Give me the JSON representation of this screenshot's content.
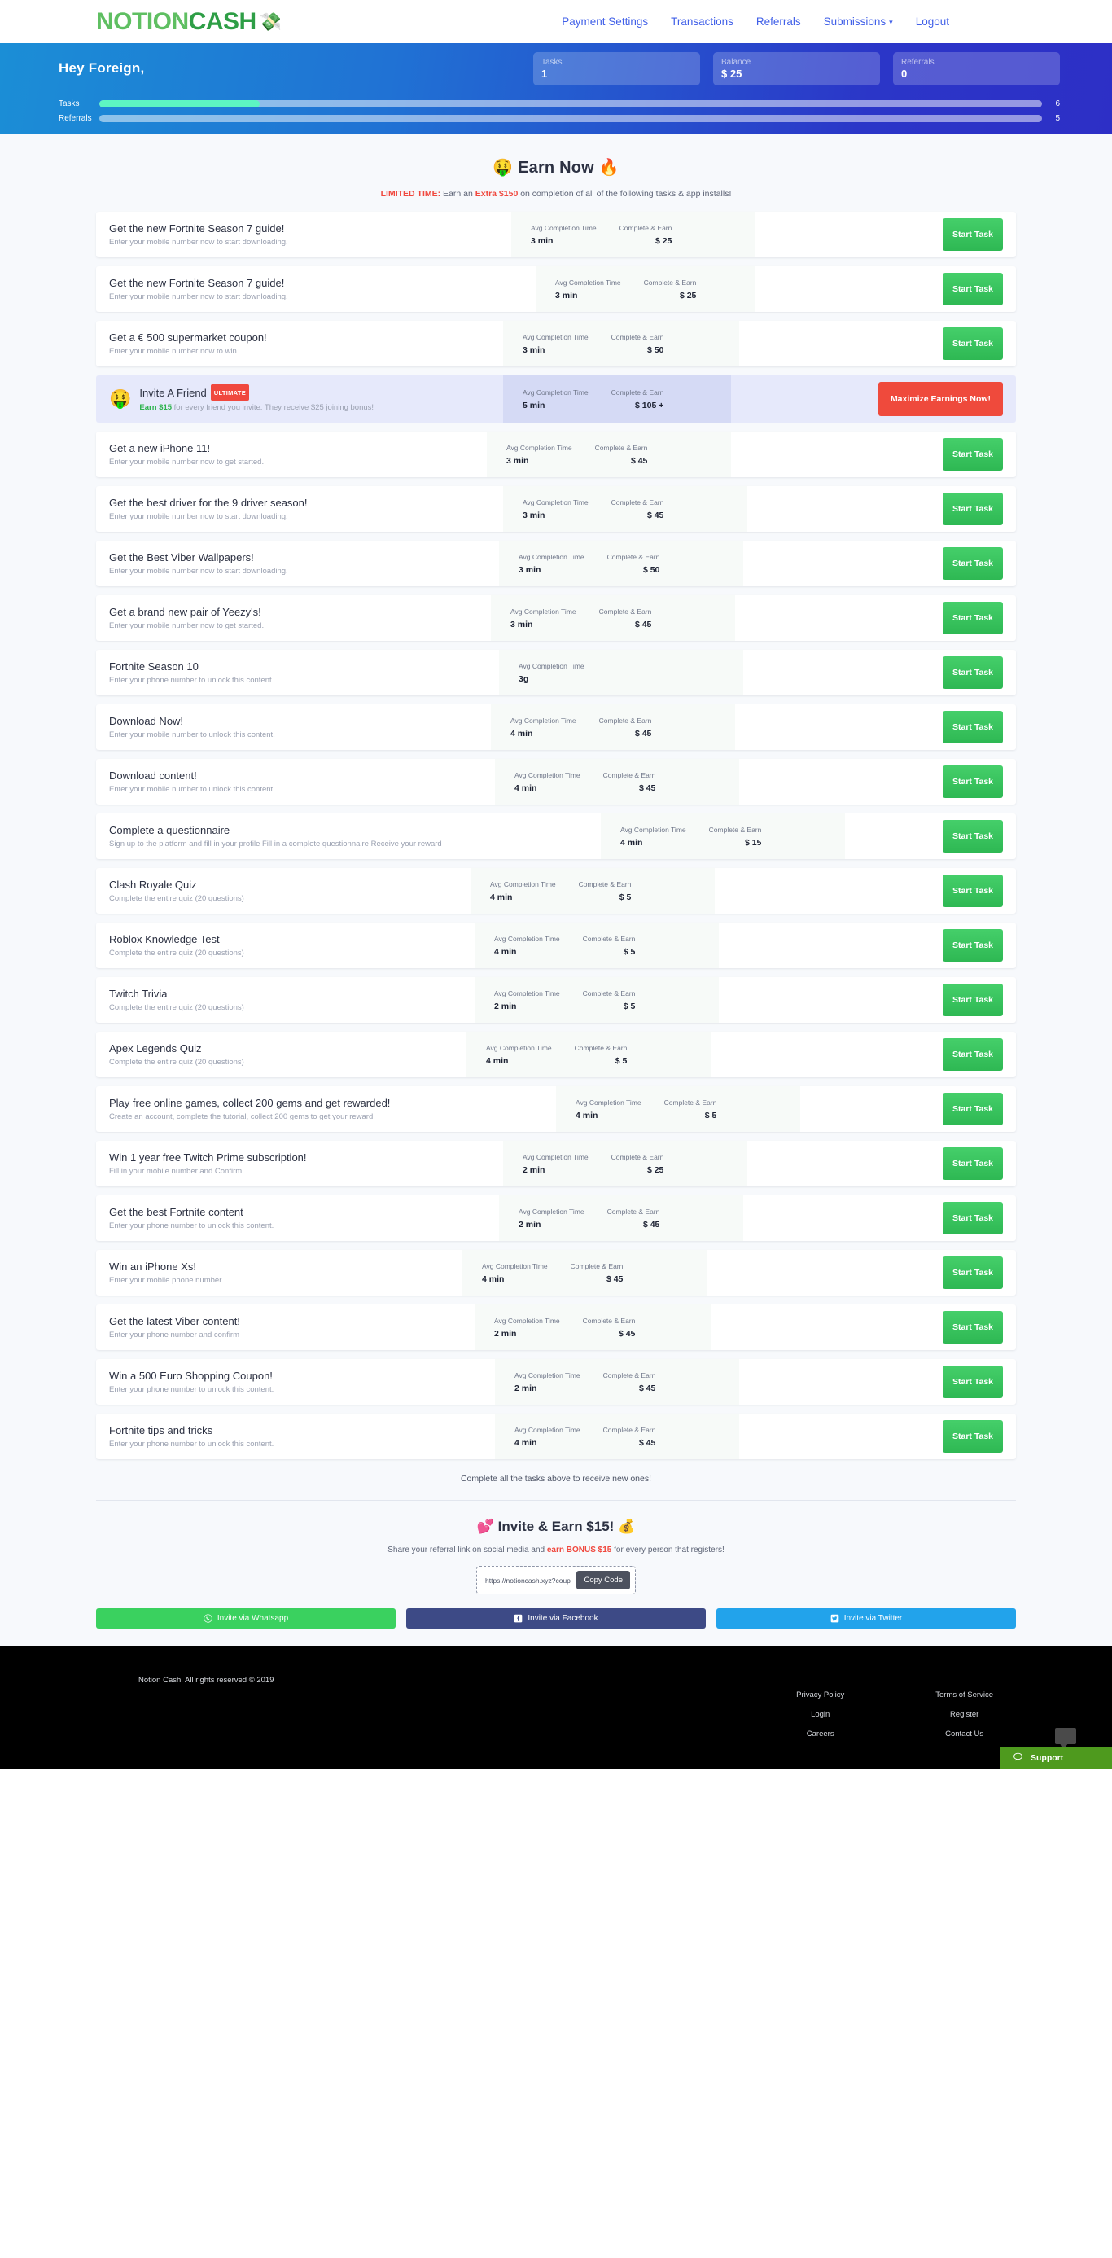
{
  "nav": {
    "brand_notion": "NOTION",
    "brand_cash": "CASH",
    "brand_emoji": "💸",
    "links": [
      {
        "label": "Payment Settings",
        "has_caret": false
      },
      {
        "label": "Transactions",
        "has_caret": false
      },
      {
        "label": "Referrals",
        "has_caret": false
      },
      {
        "label": "Submissions",
        "has_caret": true
      },
      {
        "label": "Logout",
        "has_caret": false
      }
    ]
  },
  "hero": {
    "greeting": "Hey Foreign,",
    "stats": [
      {
        "label": "Tasks",
        "value": "1"
      },
      {
        "label": "Balance",
        "value": "$ 25"
      },
      {
        "label": "Referrals",
        "value": "0"
      }
    ],
    "bars": [
      {
        "label": "Tasks",
        "max": "6",
        "percent": 17
      },
      {
        "label": "Referrals",
        "max": "5",
        "percent": 0
      }
    ]
  },
  "earn": {
    "title": "🤑 Earn Now 🔥",
    "promo_prefix": "LIMITED TIME:",
    "promo_mid": " Earn an ",
    "promo_amount": "Extra $150",
    "promo_suffix": " on completion of all of the following tasks & app installs!",
    "metric_time_label": "Avg Completion Time",
    "metric_earn_label": "Complete & Earn",
    "start_button": "Start Task",
    "featured_button": "Maximize Earnings Now!",
    "footer_note": "Complete all the tasks above to receive new ones!"
  },
  "tasks": [
    {
      "title": "Get the new Fortnite Season 7 guide!",
      "desc": "Enter your mobile number now to start downloading.",
      "time": "3 min",
      "earn": "$ 25",
      "mid_width": 300,
      "left_width": 510,
      "featured": false
    },
    {
      "title": "Get the new Fortnite Season 7 guide!",
      "desc": "Enter your mobile number now to start downloading.",
      "time": "3 min",
      "earn": "$ 25",
      "mid_width": 270,
      "left_width": 540,
      "featured": false
    },
    {
      "title": "Get a € 500 supermarket coupon!",
      "desc": "Enter your mobile number now to win.",
      "time": "3 min",
      "earn": "$ 50",
      "mid_width": 290,
      "left_width": 500,
      "featured": false
    },
    {
      "title": "Invite A Friend",
      "badge": "ULTIMATE",
      "desc_green": "Earn $15",
      "desc": " for every friend you invite. They receive $25 joining bonus!",
      "emoji": "🤑",
      "time": "5 min",
      "earn": "$ 105 +",
      "mid_width": 280,
      "left_width": 500,
      "featured": true
    },
    {
      "title": "Get a new iPhone 11!",
      "desc": "Enter your mobile number now to get started.",
      "time": "3 min",
      "earn": "$ 45",
      "mid_width": 300,
      "left_width": 480,
      "featured": false
    },
    {
      "title": "Get the best driver for the 9 driver season!",
      "desc": "Enter your mobile number now to start downloading.",
      "time": "3 min",
      "earn": "$ 45",
      "mid_width": 300,
      "left_width": 500,
      "featured": false
    },
    {
      "title": "Get the Best Viber Wallpapers!",
      "desc": "Enter your mobile number now to start downloading.",
      "time": "3 min",
      "earn": "$ 50",
      "mid_width": 300,
      "left_width": 495,
      "featured": false
    },
    {
      "title": "Get a brand new pair of Yeezy's!",
      "desc": "Enter your mobile number now to get started.",
      "time": "3 min",
      "earn": "$ 45",
      "mid_width": 300,
      "left_width": 485,
      "featured": false
    },
    {
      "title": "Fortnite Season 10",
      "desc": "Enter your phone number to unlock this content.",
      "time": "3g",
      "earn": "",
      "mid_width": 300,
      "left_width": 495,
      "featured": false
    },
    {
      "title": "Download Now!",
      "desc": "Enter your mobile number to unlock this content.",
      "time": "4 min",
      "earn": "$ 45",
      "mid_width": 300,
      "left_width": 485,
      "featured": false
    },
    {
      "title": "Download content!",
      "desc": "Enter your mobile number to unlock this content.",
      "time": "4 min",
      "earn": "$ 45",
      "mid_width": 300,
      "left_width": 490,
      "featured": false
    },
    {
      "title": "Complete a questionnaire",
      "desc": "Sign up to the platform and fill in your profile Fill in a complete questionnaire Receive your reward",
      "time": "4 min",
      "earn": "$ 15",
      "mid_width": 300,
      "left_width": 620,
      "featured": false
    },
    {
      "title": "Clash Royale Quiz",
      "desc": "Complete the entire quiz (20 questions)",
      "time": "4 min",
      "earn": "$ 5",
      "mid_width": 300,
      "left_width": 460,
      "featured": false
    },
    {
      "title": "Roblox Knowledge Test",
      "desc": "Complete the entire quiz (20 questions)",
      "time": "4 min",
      "earn": "$ 5",
      "mid_width": 300,
      "left_width": 465,
      "featured": false
    },
    {
      "title": "Twitch Trivia",
      "desc": "Complete the entire quiz (20 questions)",
      "time": "2 min",
      "earn": "$ 5",
      "mid_width": 300,
      "left_width": 465,
      "featured": false
    },
    {
      "title": "Apex Legends Quiz",
      "desc": "Complete the entire quiz (20 questions)",
      "time": "4 min",
      "earn": "$ 5",
      "mid_width": 300,
      "left_width": 455,
      "featured": false
    },
    {
      "title": "Play free online games, collect 200 gems and get rewarded!",
      "desc": "Create an account, complete the tutorial, collect 200 gems to get your reward!",
      "time": "4 min",
      "earn": "$ 5",
      "mid_width": 300,
      "left_width": 565,
      "featured": false
    },
    {
      "title": "Win 1 year free Twitch Prime subscription!",
      "desc": "Fill in your mobile number and Confirm",
      "time": "2 min",
      "earn": "$ 25",
      "mid_width": 300,
      "left_width": 500,
      "featured": false
    },
    {
      "title": "Get the best Fortnite content",
      "desc": "Enter your phone number to unlock this content.",
      "time": "2 min",
      "earn": "$ 45",
      "mid_width": 300,
      "left_width": 495,
      "featured": false
    },
    {
      "title": "Win an iPhone Xs!",
      "desc": "Enter your mobile phone number",
      "time": "4 min",
      "earn": "$ 45",
      "mid_width": 300,
      "left_width": 450,
      "featured": false
    },
    {
      "title": "Get the latest Viber content!",
      "desc": "Enter your phone number and confirm",
      "time": "2 min",
      "earn": "$ 45",
      "mid_width": 290,
      "left_width": 465,
      "featured": false
    },
    {
      "title": "Win a 500 Euro Shopping Coupon!",
      "desc": "Enter your phone number to unlock this content.",
      "time": "2 min",
      "earn": "$ 45",
      "mid_width": 300,
      "left_width": 490,
      "featured": false
    },
    {
      "title": "Fortnite tips and tricks",
      "desc": "Enter your phone number to unlock this content.",
      "time": "4 min",
      "earn": "$ 45",
      "mid_width": 300,
      "left_width": 490,
      "featured": false
    }
  ],
  "invite": {
    "title": "💕 Invite & Earn $15! 💰",
    "sub_prefix": "Share your referral link on social media and ",
    "sub_bonus": "earn BONUS $15",
    "sub_suffix": " for every person that registers!",
    "referral_url": "https://notioncash.xyz?coupon=Xaric",
    "copy_label": "Copy Code",
    "social": [
      {
        "label": "Invite via Whatsapp",
        "icon": "whatsapp-icon",
        "color": "#3ad15f"
      },
      {
        "label": "Invite via Facebook",
        "icon": "facebook-icon",
        "color": "#3d4a86"
      },
      {
        "label": "Invite via Twitter",
        "icon": "twitter-icon",
        "color": "#22a3eb"
      }
    ]
  },
  "footer": {
    "copyright": "Notion Cash. All rights reserved © 2019",
    "col1": [
      "Privacy Policy",
      "Login",
      "Careers"
    ],
    "col2": [
      "Terms of Service",
      "Register",
      "Contact Us"
    ],
    "support_label": "Support"
  }
}
